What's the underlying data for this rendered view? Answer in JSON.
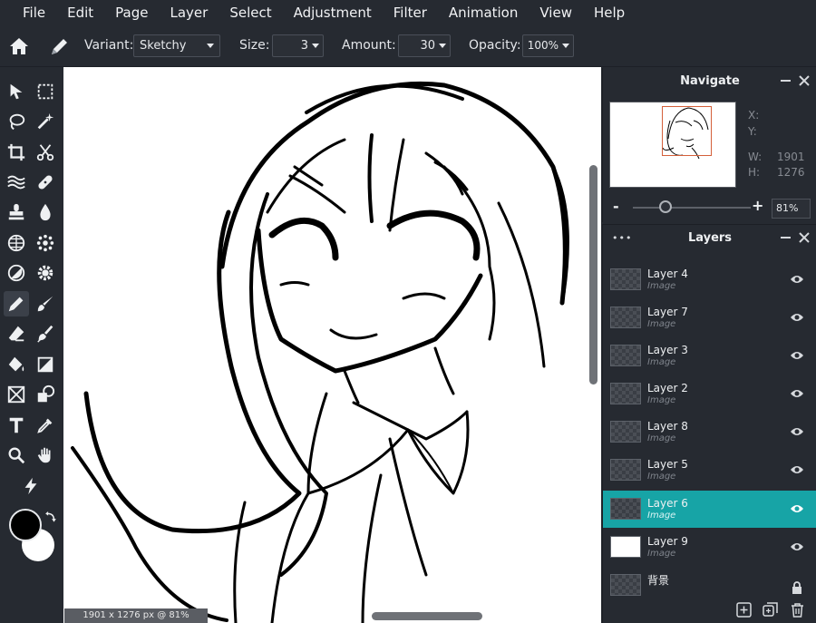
{
  "menu": [
    "File",
    "Edit",
    "Page",
    "Layer",
    "Select",
    "Adjustment",
    "Filter",
    "Animation",
    "View",
    "Help"
  ],
  "options": {
    "variant_label": "Variant:",
    "variant_value": "Sketchy",
    "size_label": "Size:",
    "size_value": "3",
    "amount_label": "Amount:",
    "amount_value": "30",
    "opacity_label": "Opacity:",
    "opacity_value": "100%"
  },
  "tools": [
    "pointer",
    "marquee",
    "lasso",
    "magic-wand",
    "crop",
    "scissors",
    "liquify",
    "healing",
    "stamp",
    "blur",
    "sponge",
    "spot-heal",
    "dodge",
    "sharpen",
    "pencil",
    "brush",
    "eraser",
    "smudge",
    "bucket",
    "gradient",
    "shape",
    "clone",
    "text",
    "color-picker",
    "zoom",
    "hand",
    "magic"
  ],
  "colors": {
    "foreground": "#000000",
    "background": "#ffffff",
    "accent": "#17a4a6"
  },
  "status": "1901 x 1276 px @ 81%",
  "navigate": {
    "title": "Navigate",
    "x_label": "X:",
    "y_label": "Y:",
    "w_label": "W:",
    "w_value": "1901",
    "h_label": "H:",
    "h_value": "1276",
    "zoom_value": "81%",
    "zoom_minus": "-",
    "zoom_plus": "+"
  },
  "layers": {
    "title": "Layers",
    "more": "•••",
    "items": [
      {
        "name": "Layer 4",
        "type": "Image"
      },
      {
        "name": "Layer 7",
        "type": "Image"
      },
      {
        "name": "Layer 3",
        "type": "Image"
      },
      {
        "name": "Layer 2",
        "type": "Image"
      },
      {
        "name": "Layer 8",
        "type": "Image"
      },
      {
        "name": "Layer 5",
        "type": "Image"
      },
      {
        "name": "Layer 6",
        "type": "Image"
      },
      {
        "name": "Layer 9",
        "type": "Image"
      },
      {
        "name": "背景",
        "type": ""
      }
    ]
  }
}
